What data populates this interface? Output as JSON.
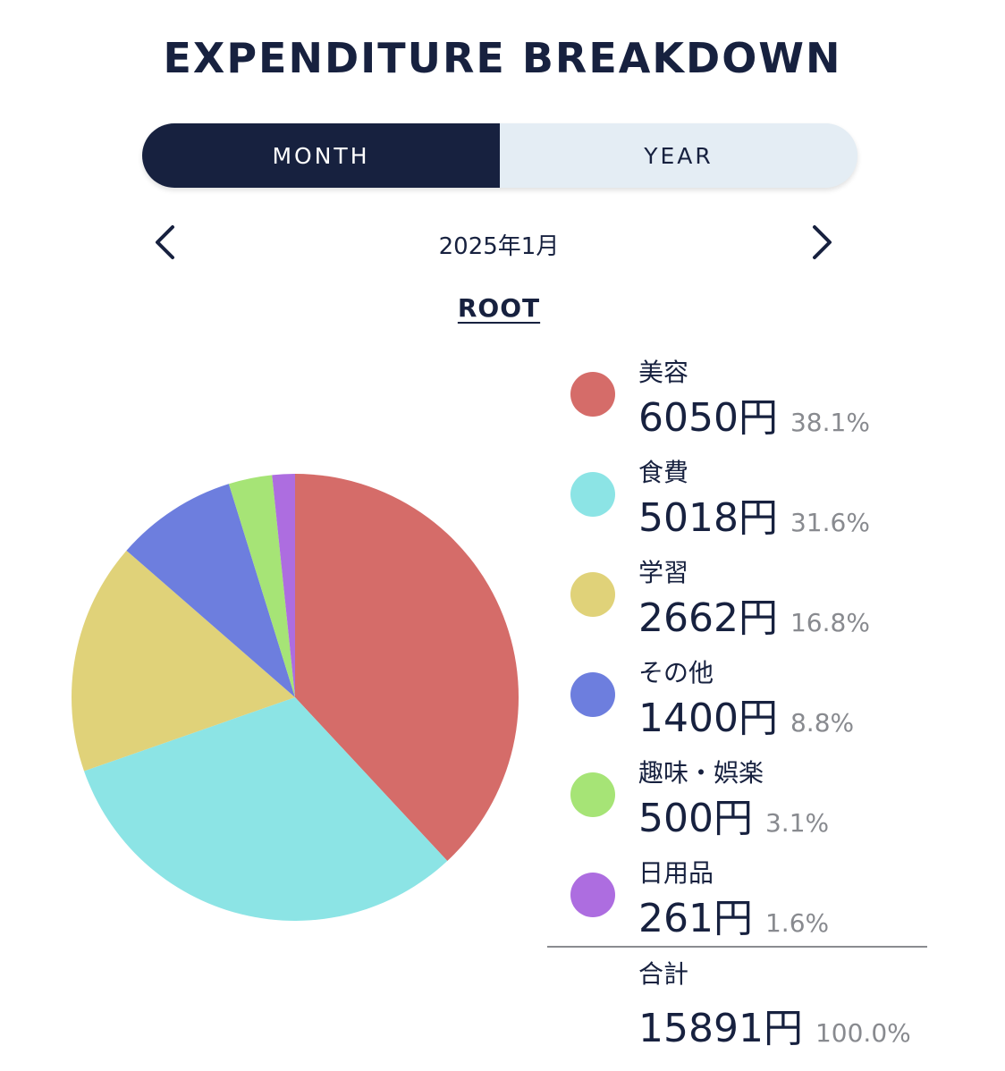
{
  "header": {
    "title": "EXPENDITURE BREAKDOWN"
  },
  "toggle": {
    "month_label": "MONTH",
    "year_label": "YEAR",
    "active": "month"
  },
  "period": {
    "label": "2025年1月"
  },
  "breadcrumb": {
    "root_label": "ROOT"
  },
  "icons": {
    "prev": "chevron-left-icon",
    "next": "chevron-right-icon"
  },
  "legend": {
    "items": [
      {
        "name": "美容",
        "amount": "6050円",
        "percent": "38.1%",
        "color": "#d56c69"
      },
      {
        "name": "食費",
        "amount": "5018円",
        "percent": "31.6%",
        "color": "#8ce4e5"
      },
      {
        "name": "学習",
        "amount": "2662円",
        "percent": "16.8%",
        "color": "#e0d279"
      },
      {
        "name": "その他",
        "amount": "1400円",
        "percent": "8.8%",
        "color": "#6d7ede"
      },
      {
        "name": "趣味・娯楽",
        "amount": "500円",
        "percent": "3.1%",
        "color": "#a6e476"
      },
      {
        "name": "日用品",
        "amount": "261円",
        "percent": "1.6%",
        "color": "#ad6de0"
      }
    ],
    "total": {
      "name": "合計",
      "amount": "15891円",
      "percent": "100.0%"
    }
  },
  "chart_data": {
    "type": "pie",
    "categories": [
      "美容",
      "食費",
      "学習",
      "その他",
      "趣味・娯楽",
      "日用品"
    ],
    "values": [
      6050,
      5018,
      2662,
      1400,
      500,
      261
    ],
    "colors": [
      "#d56c69",
      "#8ce4e5",
      "#e0d279",
      "#6d7ede",
      "#a6e476",
      "#ad6de0"
    ],
    "start": "top",
    "direction": "clockwise"
  }
}
